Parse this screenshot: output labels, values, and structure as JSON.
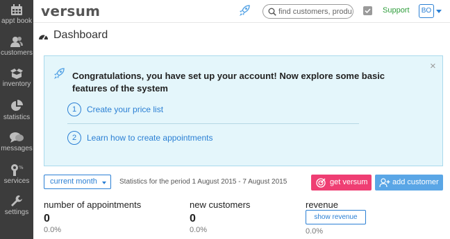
{
  "sidebar": {
    "items": [
      {
        "label": "appt book",
        "icon": "calendar-icon"
      },
      {
        "label": "customers",
        "icon": "customers-icon"
      },
      {
        "label": "inventory",
        "icon": "inventory-icon"
      },
      {
        "label": "statistics",
        "icon": "pie-chart-icon"
      },
      {
        "label": "messages",
        "icon": "messages-icon"
      },
      {
        "label": "services",
        "icon": "services-icon"
      },
      {
        "label": "settings",
        "icon": "wrench-icon"
      }
    ]
  },
  "header": {
    "logo": "versum",
    "search_placeholder": "find customers, products",
    "support_label": "Support",
    "user_initials": "BO"
  },
  "page": {
    "title": "Dashboard"
  },
  "banner": {
    "title": "Congratulations, you have set up your account! Now explore some basic features of the system",
    "close": "×",
    "steps": [
      {
        "num": "1",
        "label": "Create your price list"
      },
      {
        "num": "2",
        "label": "Learn how to create appointments"
      }
    ]
  },
  "toolbar": {
    "period_label": "current month",
    "period_text": "Statistics for the period 1 August 2015 - 7 August 2015",
    "get_versum_label": "get versum",
    "add_customer_label": "add customer"
  },
  "stats": {
    "appointments": {
      "label": "number of appointments",
      "value": "0",
      "pct": "0.0%"
    },
    "new_customers": {
      "label": "new customers",
      "value": "0",
      "pct": "0.0%"
    },
    "revenue": {
      "label": "revenue",
      "button": "show revenue",
      "pct": "0.0%"
    }
  },
  "colors": {
    "accent": "#2a7fd4",
    "sidebar_bg": "#3c3c3c",
    "support_green": "#2e9d3b",
    "get_versum_pink": "#ef3e73",
    "add_customer_blue": "#5aa6e6",
    "banner_bg": "#e4f6fb"
  }
}
